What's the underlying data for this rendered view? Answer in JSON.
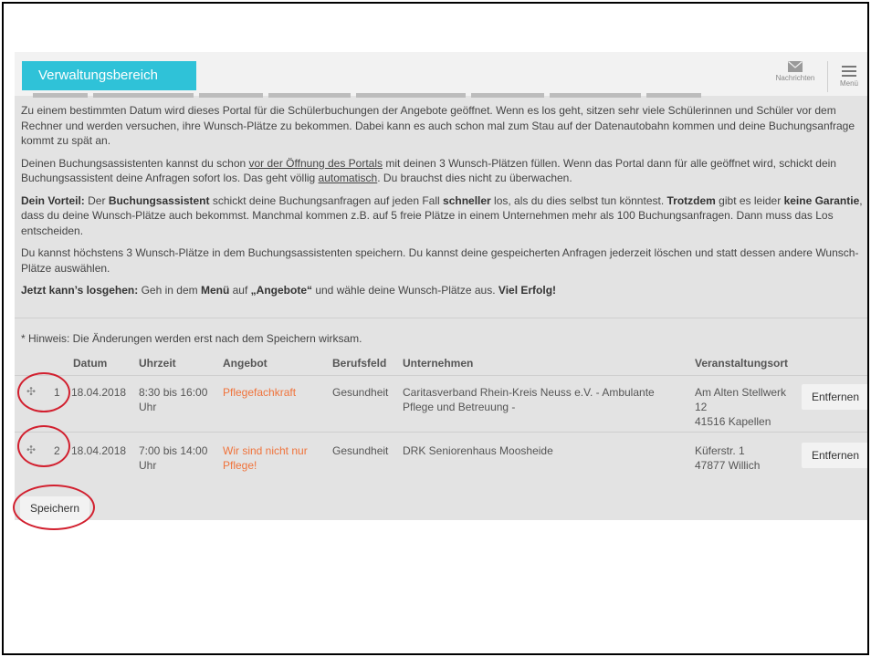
{
  "app": {
    "title": "Verwaltungsbereich",
    "messages_label": "Nachrichten",
    "menu_label": "Menü"
  },
  "intro": {
    "p1": "Zu einem bestimmten Datum wird dieses Portal für die Schülerbuchungen der Angebote geöffnet. Wenn es los geht, sitzen sehr viele Schülerinnen und Schüler vor dem Rechner und werden versuchen, ihre Wunsch-Plätze zu bekommen. Dabei kann es auch schon mal zum Stau auf der Datenautobahn kommen und deine Buchungsanfrage kommt zu spät an.",
    "p2_a": "Deinen Buchungsassistenten kannst du schon ",
    "p2_link1": "vor der Öffnung des Portals",
    "p2_b": " mit deinen 3 Wunsch-Plätzen füllen. Wenn das Portal dann für alle geöffnet wird, schickt dein Buchungsassistent deine Anfragen sofort los. Das geht völlig ",
    "p2_link2": "automatisch",
    "p2_c": ". Du brauchst dies nicht zu überwachen.",
    "p3_b1": "Dein Vorteil:",
    "p3_t1": " Der ",
    "p3_b2": "Buchungsassistent",
    "p3_t2": " schickt deine Buchungsanfragen auf jeden Fall ",
    "p3_b3": "schneller",
    "p3_t3": " los, als du dies selbst tun könntest. ",
    "p3_b4": "Trotzdem",
    "p3_t4": " gibt es leider ",
    "p3_b5": "keine Garantie",
    "p3_t5": ", dass du deine Wunsch-Plätze auch bekommst. Manchmal kommen z.B. auf 5 freie Plätze in einem Unternehmen mehr als 100 Buchungsanfragen. Dann muss das Los entscheiden.",
    "p4": "Du kannst höchstens 3 Wunsch-Plätze in dem Buchungsassistenten speichern. Du kannst deine gespeicherten Anfragen jederzeit löschen und statt dessen andere Wunsch-Plätze auswählen.",
    "p5_b1": "Jetzt kann’s losgehen:",
    "p5_t1": " Geh in dem ",
    "p5_b2": "Menü",
    "p5_t2": " auf ",
    "p5_b3": "„Angebote“",
    "p5_t3": " und wähle deine Wunsch-Plätze aus. ",
    "p5_b4": "Viel Erfolg!"
  },
  "hint": "* Hinweis: Die Änderungen werden erst nach dem Speichern wirksam.",
  "table": {
    "headers": {
      "datum": "Datum",
      "uhrzeit": "Uhrzeit",
      "angebot": "Angebot",
      "berufsfeld": "Berufsfeld",
      "unternehmen": "Unternehmen",
      "ort": "Veranstaltungsort"
    },
    "rows": [
      {
        "handle": "✣",
        "nr": "1",
        "datum": "18.04.2018",
        "uhrzeit_1": "8:30 bis 16:00",
        "uhrzeit_2": "Uhr",
        "angebot_1": "Pflegefachkraft",
        "angebot_2": "",
        "berufsfeld": "Gesundheit",
        "unternehmen_1": "Caritasverband Rhein-Kreis Neuss e.V. - Ambulante",
        "unternehmen_2": "Pflege und Betreuung -",
        "ort_1": "Am Alten Stellwerk",
        "ort_2": "12",
        "ort_3": "41516 Kapellen",
        "remove": "Entfernen"
      },
      {
        "handle": "✣",
        "nr": "2",
        "datum": "18.04.2018",
        "uhrzeit_1": "7:00 bis 14:00",
        "uhrzeit_2": "Uhr",
        "angebot_1": "Wir sind nicht nur",
        "angebot_2": "Pflege!",
        "berufsfeld": "Gesundheit",
        "unternehmen_1": "DRK Seniorenhaus Moosheide",
        "unternehmen_2": "",
        "ort_1": "Küferstr. 1",
        "ort_2": "47877 Willich",
        "ort_3": "",
        "remove": "Entfernen"
      }
    ]
  },
  "save_label": "Speichern",
  "colors": {
    "accent": "#2fc2d8",
    "link": "#f0733b",
    "annotation": "#d2202f",
    "background": "#e3e3e3"
  }
}
